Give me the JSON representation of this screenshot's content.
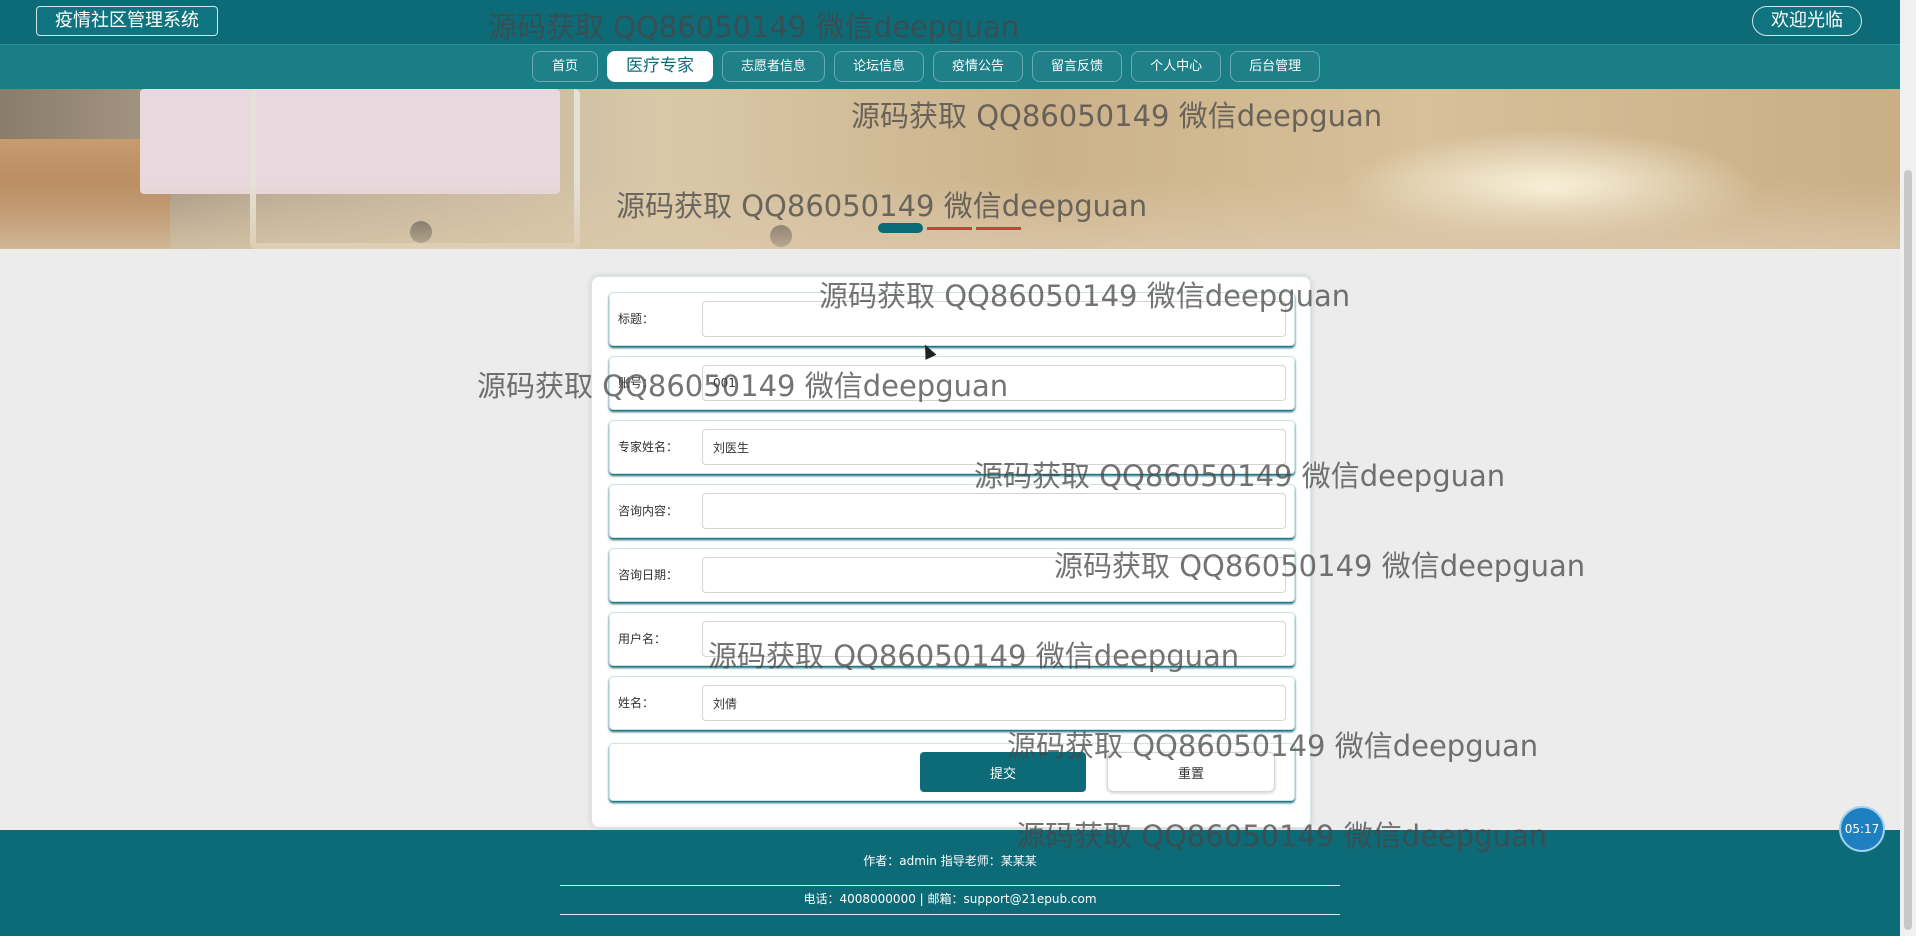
{
  "header": {
    "system_title": "疫情社区管理系统",
    "welcome": "欢迎光临"
  },
  "nav": {
    "items": [
      {
        "label": "首页",
        "active": false
      },
      {
        "label": "医疗专家",
        "active": true
      },
      {
        "label": "志愿者信息",
        "active": false
      },
      {
        "label": "论坛信息",
        "active": false
      },
      {
        "label": "疫情公告",
        "active": false
      },
      {
        "label": "留言反馈",
        "active": false
      },
      {
        "label": "个人中心",
        "active": false
      },
      {
        "label": "后台管理",
        "active": false
      }
    ]
  },
  "banner": {
    "dots": 3,
    "active_dot": 0
  },
  "form": {
    "fields": [
      {
        "label": "标题：",
        "value": ""
      },
      {
        "label": "账号：",
        "value": "001"
      },
      {
        "label": "专家姓名：",
        "value": "刘医生"
      },
      {
        "label": "咨询内容：",
        "value": ""
      },
      {
        "label": "咨询日期：",
        "value": ""
      },
      {
        "label": "用户名：",
        "value": ""
      },
      {
        "label": "姓名：",
        "value": "刘倩"
      }
    ],
    "submit_label": "提交",
    "reset_label": "重置"
  },
  "footer": {
    "line1": "作者：admin 指导老师：某某某",
    "line2": "电话：4008000000 | 邮箱：support@21epub.com"
  },
  "timer": "05:17",
  "watermark": "源码获取 QQ86050149 微信deepguan",
  "colors": {
    "primary": "#0d6b78",
    "nav_bg": "#1a7e86",
    "page_bg": "#ececec"
  }
}
